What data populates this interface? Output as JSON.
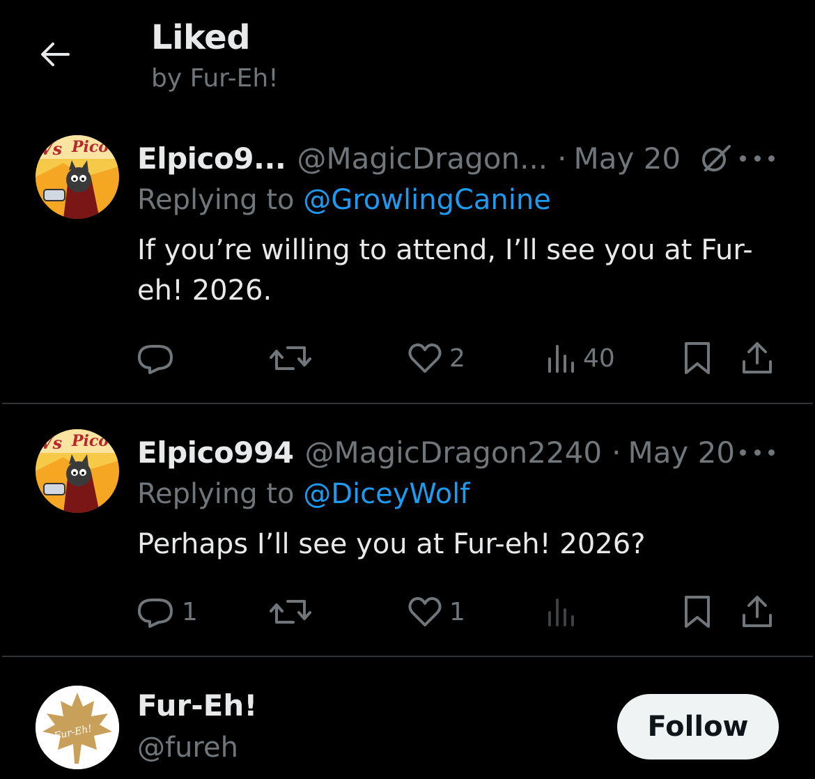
{
  "header": {
    "title": "Liked",
    "subtitle": "by Fur-Eh!"
  },
  "tweets": [
    {
      "name": "Elpico9...",
      "handle": "@MagicDragon...",
      "separator": "·",
      "date": "May 20",
      "reply_prefix": "Replying to",
      "reply_to": "@GrowlingCanine",
      "text": "If you’re willing to attend, I’ll see you at Fur-eh! 2026.",
      "replies": "",
      "reposts": "",
      "likes": "2",
      "views": "40",
      "avatar_text": "VS Pico"
    },
    {
      "name": "Elpico994",
      "handle": "@MagicDragon2240",
      "separator": "·",
      "date": "May 20",
      "reply_prefix": "Replying to",
      "reply_to": "@DiceyWolf",
      "text": "Perhaps I’ll see you at Fur-eh! 2026?",
      "replies": "1",
      "reposts": "",
      "likes": "1",
      "views": "",
      "avatar_text": "VS Pico"
    }
  ],
  "profile": {
    "name": "Fur-Eh!",
    "handle": "@fureh",
    "follow_label": "Follow",
    "avatar_text": "Fur-Eh!"
  },
  "colors": {
    "background": "#000000",
    "text_primary": "#e7e9ea",
    "text_secondary": "#71767b",
    "link": "#1d9bf0",
    "divider": "#2f3336",
    "follow_bg": "#eff3f4"
  },
  "icons": [
    "back-arrow-icon",
    "grok-icon",
    "more-icon",
    "reply-icon",
    "repost-icon",
    "like-icon",
    "views-icon",
    "bookmark-icon",
    "share-icon"
  ]
}
